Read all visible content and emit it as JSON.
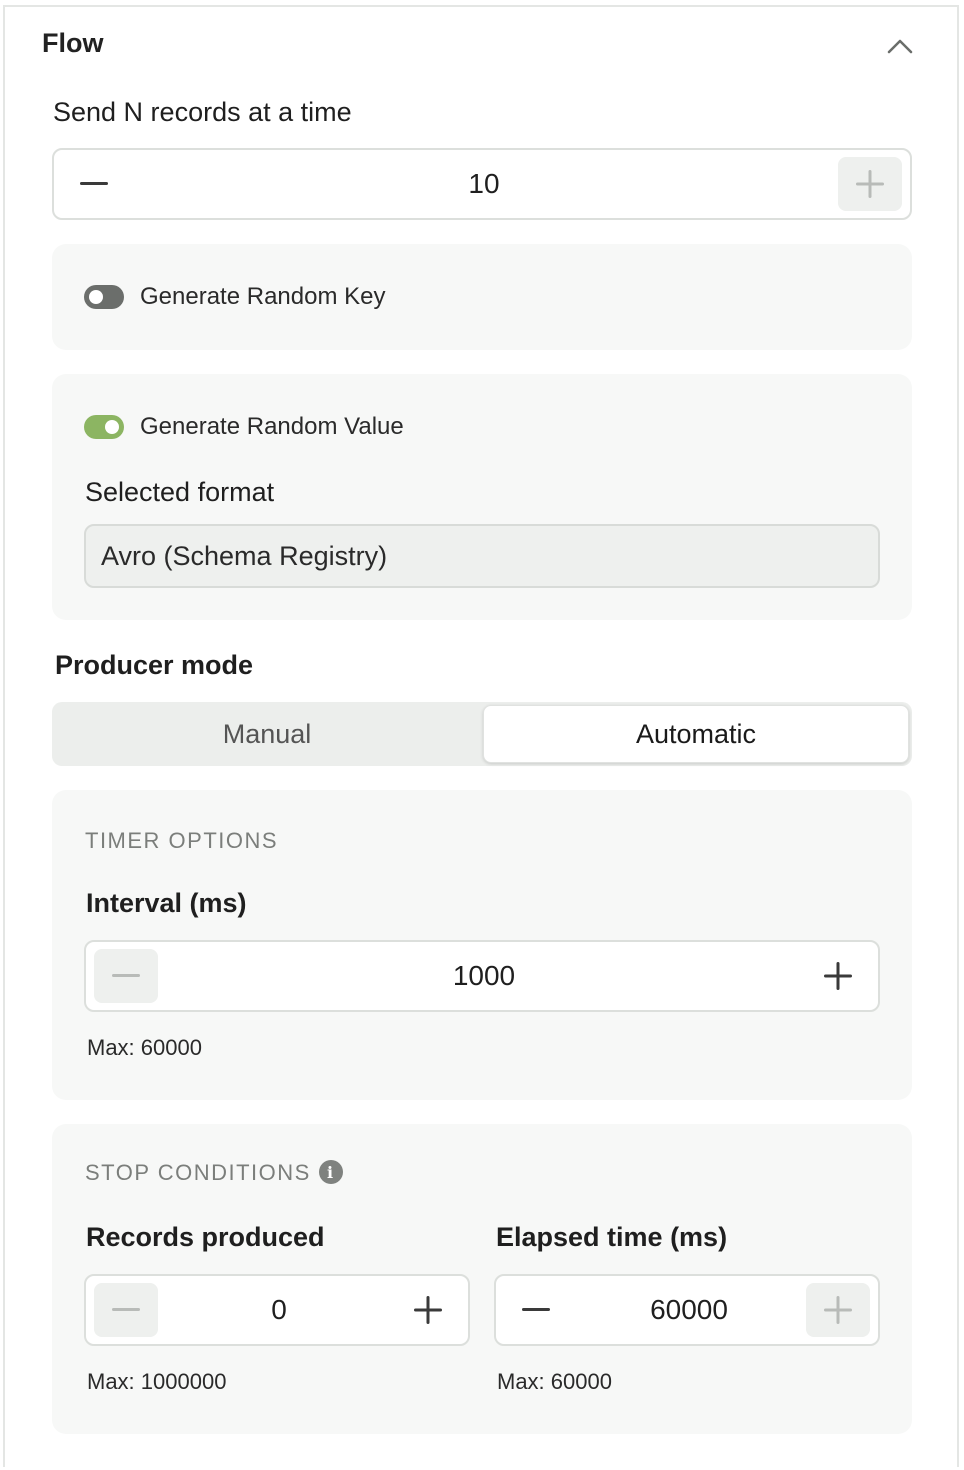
{
  "flow": {
    "title": "Flow",
    "collapse_icon": "chevron-up-icon"
  },
  "batch": {
    "label": "Send N records at a time",
    "value": "10"
  },
  "random_key": {
    "label": "Generate Random Key",
    "enabled": false
  },
  "random_value": {
    "label": "Generate Random Value",
    "enabled": true,
    "format_label": "Selected format",
    "format_value": "Avro (Schema Registry)"
  },
  "producer_mode": {
    "label": "Producer mode",
    "options": [
      "Manual",
      "Automatic"
    ],
    "selected": "Automatic"
  },
  "timer_options": {
    "heading": "TIMER OPTIONS",
    "interval_label": "Interval (ms)",
    "interval_value": "1000",
    "interval_max": "Max: 60000"
  },
  "stop_conditions": {
    "heading": "STOP CONDITIONS",
    "info_icon": "info-icon",
    "records_label": "Records produced",
    "records_value": "0",
    "records_max": "Max: 1000000",
    "elapsed_label": "Elapsed time (ms)",
    "elapsed_value": "60000",
    "elapsed_max": "Max: 60000"
  },
  "colors": {
    "toggle_on": "#8cb562",
    "toggle_off": "#6b6e6b",
    "card_bg": "#f7f8f7",
    "disabled_btn": "#eef0ee"
  }
}
